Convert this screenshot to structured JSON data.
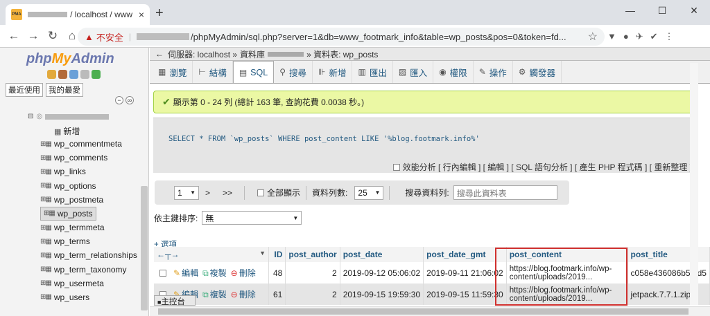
{
  "browser": {
    "tab_title": "/ localhost / www",
    "tab_close": "×",
    "new_tab": "+",
    "security_label": "不安全",
    "url_path": "/phpMyAdmin/sql.php?server=1&db=www_footmark_info&table=wp_posts&pos=0&token=fd...",
    "window_controls": [
      "—",
      "☐",
      "✕"
    ]
  },
  "sidebar": {
    "logo_php": "php",
    "logo_my": "My",
    "logo_admin": "Admin",
    "tabs": [
      "最近使用",
      "我的最愛"
    ],
    "new_label": "新增",
    "tables": [
      "wp_commentmeta",
      "wp_comments",
      "wp_links",
      "wp_options",
      "wp_postmeta",
      "wp_posts",
      "wp_termmeta",
      "wp_terms",
      "wp_term_relationships",
      "wp_term_taxonomy",
      "wp_usermeta",
      "wp_users"
    ],
    "selected_table": "wp_posts"
  },
  "breadcrumb": {
    "server": "伺服器: localhost »",
    "database": "資料庫",
    "table": "» 資料表: wp_posts"
  },
  "menu": [
    "瀏覽",
    "結構",
    "SQL",
    "搜尋",
    "新增",
    "匯出",
    "匯入",
    "權限",
    "操作",
    "觸發器"
  ],
  "success_message": "顯示第 0 - 24 列 (總計 163 筆, 查詢花費 0.0038 秒。)",
  "sql_query": "SELECT * FROM `wp_posts` WHERE post_content LIKE '%blog.footmark.info%'",
  "sql_links": "效能分析 [ 行內編輯 ] [ 編輯 ] [ SQL 語句分析 ] [ 產生 PHP 程式碼 ] [ 重新整理 ]",
  "pager": {
    "page": "1",
    "next": ">",
    "last": ">>",
    "show_all": "全部顯示",
    "rows_label": "資料列數:",
    "rows_value": "25",
    "search_label": "搜尋資料列:",
    "search_placeholder": "搜尋此資料表"
  },
  "sort": {
    "label": "依主鍵排序:",
    "value": "無"
  },
  "options_label": "+ 選項",
  "table": {
    "headers": [
      "ID",
      "post_author",
      "post_date",
      "post_date_gmt",
      "post_content",
      "post_title"
    ],
    "actions": [
      "編輯",
      "複製",
      "刪除"
    ],
    "rows": [
      {
        "id": "48",
        "author": "2",
        "date": "2019-09-12 05:06:02",
        "date_gmt": "2019-09-11 21:06:02",
        "content1": "https://blog.footmark.info/wp-",
        "content2": "content/uploads/2019...",
        "title": "c058e436086b5f7d5"
      },
      {
        "id": "61",
        "author": "2",
        "date": "2019-09-15 19:59:30",
        "date_gmt": "2019-09-15 11:59:30",
        "content1": "https://blog.footmark.info/wp-",
        "content2": "content/uploads/2019...",
        "title": "jetpack.7.7.1.zip"
      }
    ]
  },
  "console_label": "主控台"
}
